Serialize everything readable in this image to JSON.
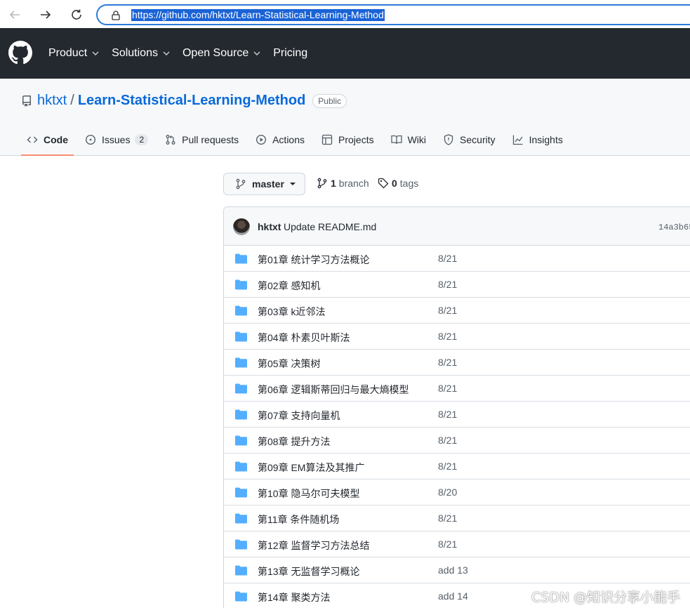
{
  "browser": {
    "url": "https://github.com/hktxt/Learn-Statistical-Learning-Method"
  },
  "gh_nav": {
    "items": [
      {
        "label": "Product",
        "dropdown": true
      },
      {
        "label": "Solutions",
        "dropdown": true
      },
      {
        "label": "Open Source",
        "dropdown": true
      },
      {
        "label": "Pricing",
        "dropdown": false
      }
    ]
  },
  "repo": {
    "owner": "hktxt",
    "separator": "/",
    "name": "Learn-Statistical-Learning-Method",
    "visibility": "Public"
  },
  "tabs": [
    {
      "label": "Code",
      "icon": "code-icon",
      "active": true
    },
    {
      "label": "Issues",
      "icon": "issue-icon",
      "count": "2"
    },
    {
      "label": "Pull requests",
      "icon": "pull-request-icon"
    },
    {
      "label": "Actions",
      "icon": "play-icon"
    },
    {
      "label": "Projects",
      "icon": "table-icon"
    },
    {
      "label": "Wiki",
      "icon": "book-icon"
    },
    {
      "label": "Security",
      "icon": "shield-icon"
    },
    {
      "label": "Insights",
      "icon": "graph-icon"
    }
  ],
  "branch": {
    "current": "master",
    "branch_count": "1",
    "branch_label": "branch",
    "tag_count": "0",
    "tag_label": "tags"
  },
  "commit": {
    "author": "hktxt",
    "message": "Update README.md",
    "sha": "14a3b65"
  },
  "files": [
    {
      "name": "第01章 统计学习方法概论",
      "date": "8/21"
    },
    {
      "name": "第02章 感知机",
      "date": "8/21"
    },
    {
      "name": "第03章 k近邻法",
      "date": "8/21"
    },
    {
      "name": "第04章 朴素贝叶斯法",
      "date": "8/21"
    },
    {
      "name": "第05章 决策树",
      "date": "8/21"
    },
    {
      "name": "第06章 逻辑斯蒂回归与最大熵模型",
      "date": "8/21"
    },
    {
      "name": "第07章 支持向量机",
      "date": "8/21"
    },
    {
      "name": "第08章 提升方法",
      "date": "8/21"
    },
    {
      "name": "第09章 EM算法及其推广",
      "date": "8/21"
    },
    {
      "name": "第10章 隐马尔可夫模型",
      "date": "8/20"
    },
    {
      "name": "第11章 条件随机场",
      "date": "8/21"
    },
    {
      "name": "第12章 监督学习方法总结",
      "date": "8/21"
    },
    {
      "name": "第13章 无监督学习概论",
      "date": "add 13"
    },
    {
      "name": "第14章 聚类方法",
      "date": "add 14"
    }
  ],
  "watermark": "CSDN @知识分享小能手",
  "colors": {
    "header_bg": "#24292f",
    "link": "#0969da",
    "folder": "#54aeff",
    "active_tab_underline": "#fd8c73",
    "url_highlight": "#1a63d6"
  }
}
